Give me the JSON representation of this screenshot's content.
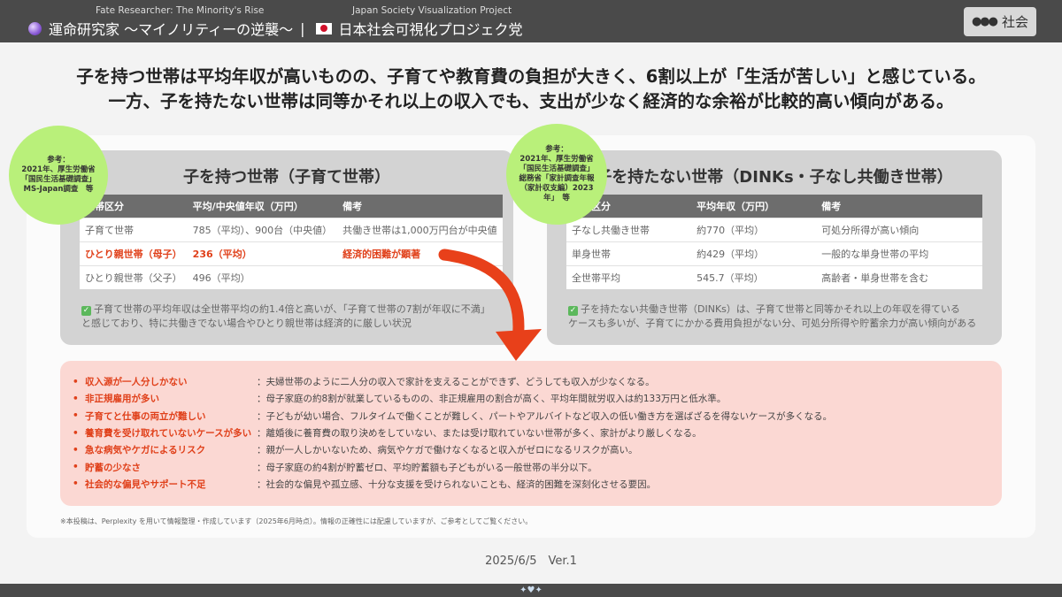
{
  "header": {
    "subtitle_left": "Fate Researcher: The Minority's Rise",
    "subtitle_right": "Japan Society Visualization Project",
    "title_left": "運命研究家 〜マイノリティーの逆襲〜",
    "separator": "|",
    "title_right": "日本社会可視化プロジェク党",
    "category_label": "社会",
    "icons": [
      "crystal-ball-icon",
      "japan-flag-icon",
      "people-icon"
    ]
  },
  "headline": {
    "line1": "子を持つ世帯は平均年収が高いものの、子育てや教育費の負担が大きく、6割以上が「生活が苦しい」と感じている。",
    "line2": "一方、子を持たない世帯は同等かそれ以上の収入でも、支出が少なく経済的な余裕が比較的高い傾向がある。"
  },
  "badge_left": {
    "line1": "参考：",
    "line2": "2021年、厚生労働省",
    "line3": "「国民生活基礎調査」",
    "line4": "MS-Japan調査　等"
  },
  "badge_right": {
    "line1": "参考：",
    "line2": "2021年、厚生労働省",
    "line3": "「国民生活基礎調査」",
    "line4": "総務省「家計調査年報",
    "line5": "（家計収支編）2023",
    "line6": "年」　等"
  },
  "left_box": {
    "title": "子を持つ世帯（子育て世帯）",
    "headers": [
      "世帯区分",
      "平均/中央値年収（万円）",
      "備考"
    ],
    "rows": [
      [
        "子育て世帯",
        "785（平均）、900台（中央値）",
        "共働き世帯は1,000万円台が中央値"
      ],
      [
        "ひとり親世帯（母子）",
        "236（平均）",
        "経済的困難が顕著"
      ],
      [
        "ひとり親世帯（父子）",
        "496（平均）",
        ""
      ]
    ],
    "note_line1": "子育て世帯の平均年収は全世帯平均の約1.4倍と高いが、「子育て世帯の7割が年収に不満」",
    "note_line2": "と感じており、特に共働きでない場合やひとり親世帯は経済的に厳しい状況"
  },
  "right_box": {
    "title": "子を持たない世帯（DINKs・子なし共働き世帯）",
    "headers": [
      "世帯区分",
      "平均年収（万円）",
      "備考"
    ],
    "rows": [
      [
        "子なし共働き世帯",
        "約770（平均）",
        "可処分所得が高い傾向"
      ],
      [
        "単身世帯",
        "約429（平均）",
        "一般的な単身世帯の平均"
      ],
      [
        "全世帯平均",
        "545.7（平均）",
        "高齢者・単身世帯を含む"
      ]
    ],
    "note_line1": "子を持たない共働き世帯（DINKs）は、子育て世帯と同等かそれ以上の年収を得ている",
    "note_line2": "ケースも多いが、子育てにかかる費用負担がない分、可処分所得や貯蓄余力が高い傾向がある"
  },
  "reasons": [
    {
      "label": "収入源が一人分しかない",
      "desc": "：夫婦世帯のように二人分の収入で家計を支えることができず、どうしても収入が少なくなる。"
    },
    {
      "label": "非正規雇用が多い",
      "desc": "：母子家庭の約8割が就業しているものの、非正規雇用の割合が高く、平均年間就労収入は約133万円と低水準。"
    },
    {
      "label": "子育てと仕事の両立が難しい",
      "desc": "：子どもが幼い場合、フルタイムで働くことが難しく、パートやアルバイトなど収入の低い働き方を選ばざるを得ないケースが多くなる。"
    },
    {
      "label": "養育費を受け取れていないケースが多い",
      "desc": "：離婚後に養育費の取り決めをしていない、または受け取れていない世帯が多く、家計がより厳しくなる。"
    },
    {
      "label": "急な病気やケガによるリスク",
      "desc": "：親が一人しかいないため、病気やケガで働けなくなると収入がゼロになるリスクが高い。"
    },
    {
      "label": "貯蓄の少なさ",
      "desc": "：母子家庭の約4割が貯蓄ゼロ、平均貯蓄額も子どもがいる一般世帯の半分以下。"
    },
    {
      "label": "社会的な偏見やサポート不足",
      "desc": "：社会的な偏見や孤立感、十分な支援を受けられないことも、経済的困難を深刻化させる要因。"
    }
  ],
  "footnote": "※本投稿は、Perplexity を用いて情報整理・作成しています（2025年6月時点）。情報の正確性には配慮していますが、ご参考としてご覧ください。",
  "version": "2025/6/5　Ver.1",
  "colors": {
    "header_bg": "#4a4a4a",
    "accent_red": "#e0401a",
    "badge_green": "#b9f07a",
    "reason_bg": "#fbd8d3"
  }
}
